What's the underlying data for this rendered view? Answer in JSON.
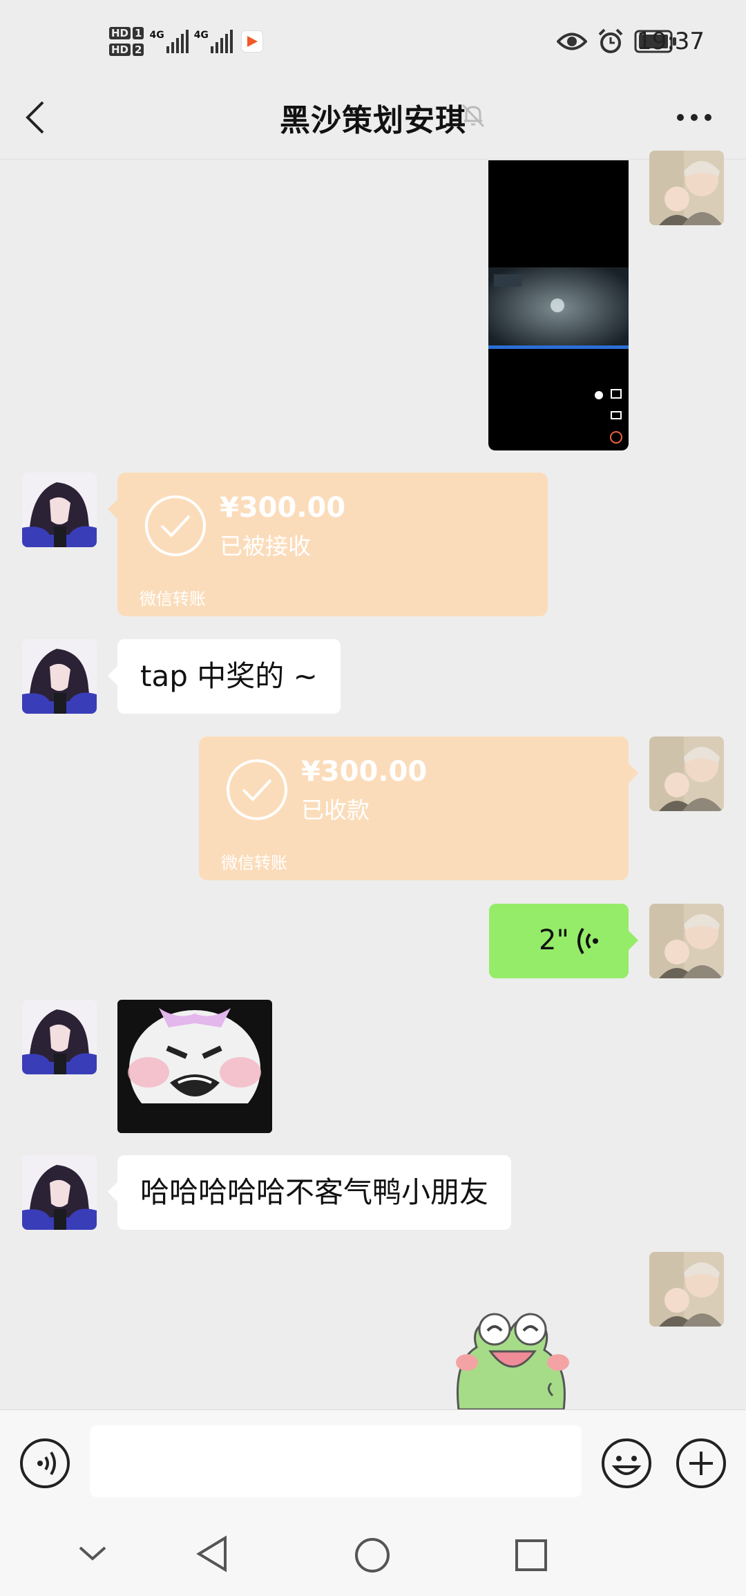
{
  "status": {
    "time": "19:37",
    "sim1": "1",
    "sim2": "2",
    "hd": "HD",
    "network": "4G"
  },
  "header": {
    "title": "黑沙策划安琪"
  },
  "messages": {
    "transfer_in": {
      "amount": "¥300.00",
      "status": "已被接收",
      "footer": "微信转账"
    },
    "text_1": "tap 中奖的 ~",
    "transfer_out": {
      "amount": "¥300.00",
      "status": "已收款",
      "footer": "微信转账"
    },
    "voice": {
      "duration": "2\""
    },
    "text_2": "哈哈哈哈哈不客气鸭小朋友"
  },
  "colors": {
    "transfer": "#fbdcba",
    "voice": "#95ec69",
    "background": "#ededed"
  },
  "icons": [
    "back-arrow-icon",
    "mute-bell-icon",
    "more-icon",
    "voice-input-icon",
    "emoji-icon",
    "plus-icon",
    "nav-collapse-icon",
    "nav-back-icon",
    "nav-home-icon",
    "nav-recents-icon"
  ]
}
